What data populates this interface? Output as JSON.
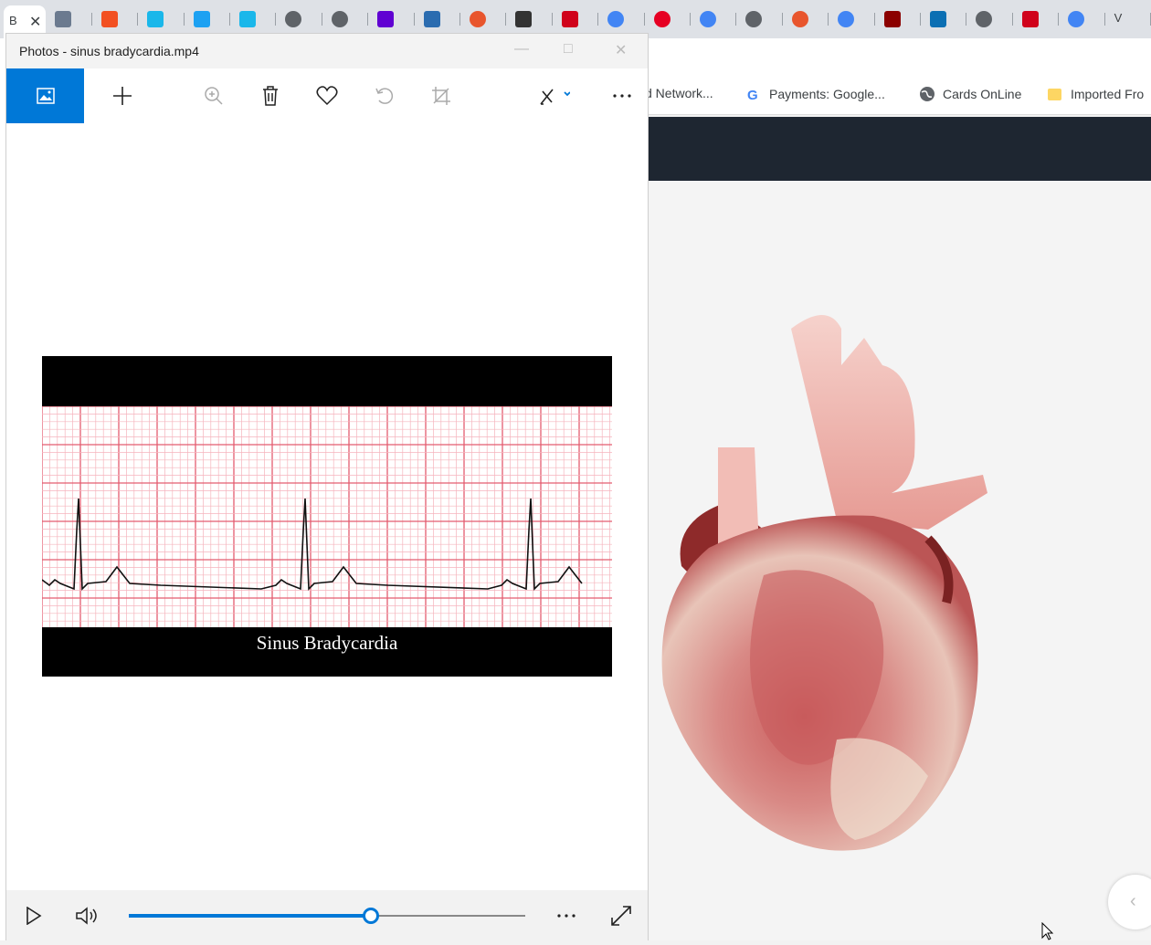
{
  "browser": {
    "tabs": [
      {
        "label": "B",
        "active": true,
        "color": "#ffffff"
      },
      {
        "icon": "grayscale-photo-icon",
        "color": "#6b7a8f"
      },
      {
        "icon": "microsoft-logo-icon",
        "color": "#f25022"
      },
      {
        "icon": "vimeo-icon",
        "color": "#1ab7ea"
      },
      {
        "icon": "refresh-circle-icon",
        "color": "#1da1f2"
      },
      {
        "icon": "vimeo-icon",
        "color": "#1ab7ea"
      },
      {
        "icon": "globe-icon",
        "color": "#5f6368"
      },
      {
        "icon": "globe-icon",
        "color": "#5f6368"
      },
      {
        "icon": "mail-icon",
        "color": "#6001d2"
      },
      {
        "icon": "shield-icon",
        "color": "#2b6cb0"
      },
      {
        "icon": "ring-icon",
        "color": "#e8552d"
      },
      {
        "icon": "s-logo-icon",
        "color": "#333333"
      },
      {
        "icon": "flag-icon",
        "color": "#d0021b"
      },
      {
        "icon": "google-icon",
        "color": "#4285f4"
      },
      {
        "icon": "pinterest-icon",
        "color": "#e60023"
      },
      {
        "icon": "google-icon",
        "color": "#4285f4"
      },
      {
        "icon": "globe-icon",
        "color": "#5f6368"
      },
      {
        "icon": "ring-icon",
        "color": "#e8552d"
      },
      {
        "icon": "google-icon",
        "color": "#4285f4"
      },
      {
        "icon": "heart-icon",
        "color": "#8b0000"
      },
      {
        "icon": "r-logo-icon",
        "color": "#0b6fb3"
      },
      {
        "icon": "globe-icon",
        "color": "#5f6368"
      },
      {
        "icon": "flag-icon",
        "color": "#d0021b"
      },
      {
        "icon": "google-icon",
        "color": "#4285f4"
      },
      {
        "label": "V",
        "icon": "v-logo-icon",
        "color": "#000000"
      }
    ],
    "bookmarks": [
      {
        "label": "d Network...",
        "icon": ""
      },
      {
        "label": "Payments: Google...",
        "icon": "google-icon"
      },
      {
        "label": "Cards OnLine",
        "icon": "globe-icon"
      },
      {
        "label": "Imported Fro",
        "icon": "folder-icon"
      }
    ]
  },
  "photos": {
    "title": "Photos - sinus bradycardia.mp4",
    "caption": "Sinus Bradycardia",
    "toolbar": [
      "view-icon",
      "add-icon",
      "zoom-icon",
      "delete-icon",
      "favorite-icon",
      "rotate-icon",
      "crop-icon",
      "edit-icon",
      "more-icon"
    ],
    "progress": 0.61,
    "accent": "#0078d7"
  }
}
